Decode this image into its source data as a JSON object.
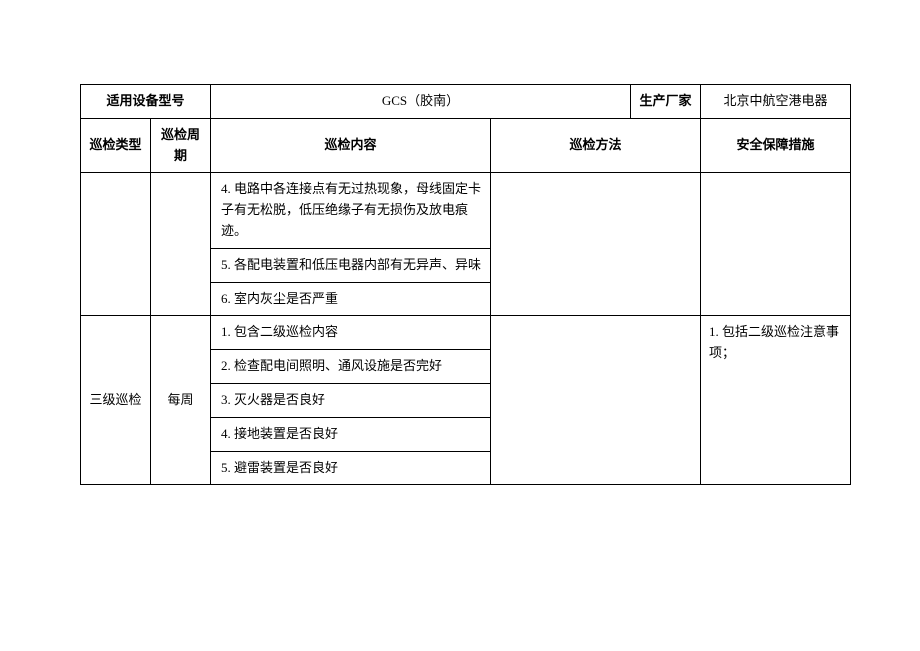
{
  "header": {
    "model_label": "适用设备型号",
    "model_value": "GCS（胶南）",
    "manufacturer_label": "生产厂家",
    "manufacturer_value": "北京中航空港电器"
  },
  "columns": {
    "type": "巡检类型",
    "cycle": "巡检周期",
    "content": "巡检内容",
    "method": "巡检方法",
    "safety": "安全保障措施"
  },
  "group1": {
    "items": [
      "4. 电路中各连接点有无过热现象，母线固定卡子有无松脱，低压绝缘子有无损伤及放电痕迹。",
      "5. 各配电装置和低压电器内部有无异声、异味",
      "6. 室内灰尘是否严重"
    ]
  },
  "group2": {
    "type": "三级巡检",
    "cycle": "每周",
    "safety": "1. 包括二级巡检注意事项；",
    "items": [
      "1. 包含二级巡检内容",
      "2. 检查配电间照明、通风设施是否完好",
      "3. 灭火器是否良好",
      "4. 接地装置是否良好",
      "5. 避雷装置是否良好"
    ]
  }
}
